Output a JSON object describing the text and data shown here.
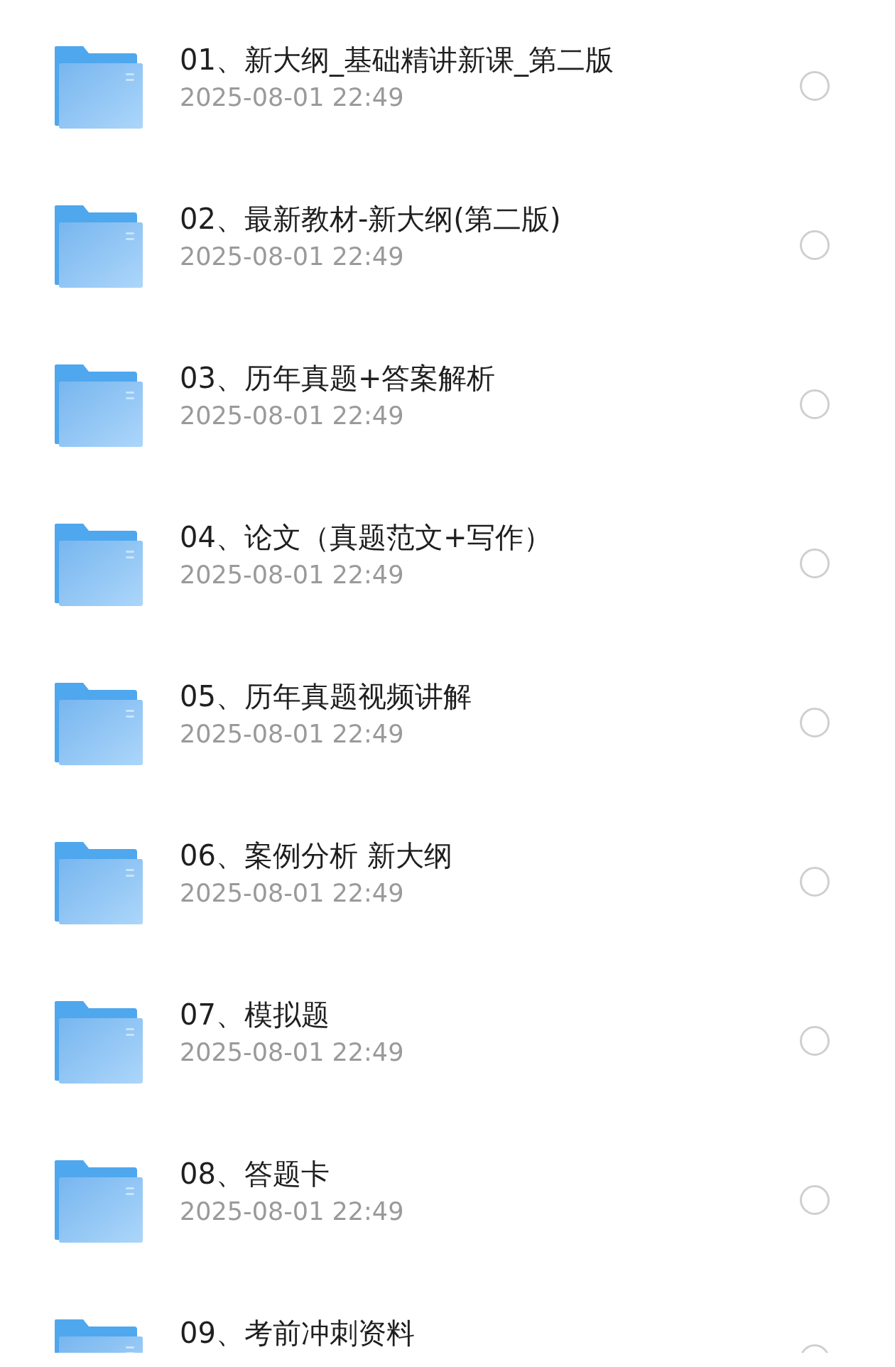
{
  "folders": [
    {
      "name": "01、新大纲_基础精讲新课_第二版",
      "date": "2025-08-01 22:49",
      "selected": false
    },
    {
      "name": "02、最新教材-新大纲(第二版)",
      "date": "2025-08-01 22:49",
      "selected": false
    },
    {
      "name": "03、历年真题+答案解析",
      "date": "2025-08-01 22:49",
      "selected": false
    },
    {
      "name": "04、论文（真题范文+写作）",
      "date": "2025-08-01 22:49",
      "selected": false
    },
    {
      "name": "05、历年真题视频讲解",
      "date": "2025-08-01 22:49",
      "selected": false
    },
    {
      "name": "06、案例分析 新大纲",
      "date": "2025-08-01 22:49",
      "selected": false
    },
    {
      "name": "07、模拟题",
      "date": "2025-08-01 22:49",
      "selected": false
    },
    {
      "name": "08、答题卡",
      "date": "2025-08-01 22:49",
      "selected": false
    },
    {
      "name": "09、考前冲刺资料",
      "selected": false
    }
  ]
}
